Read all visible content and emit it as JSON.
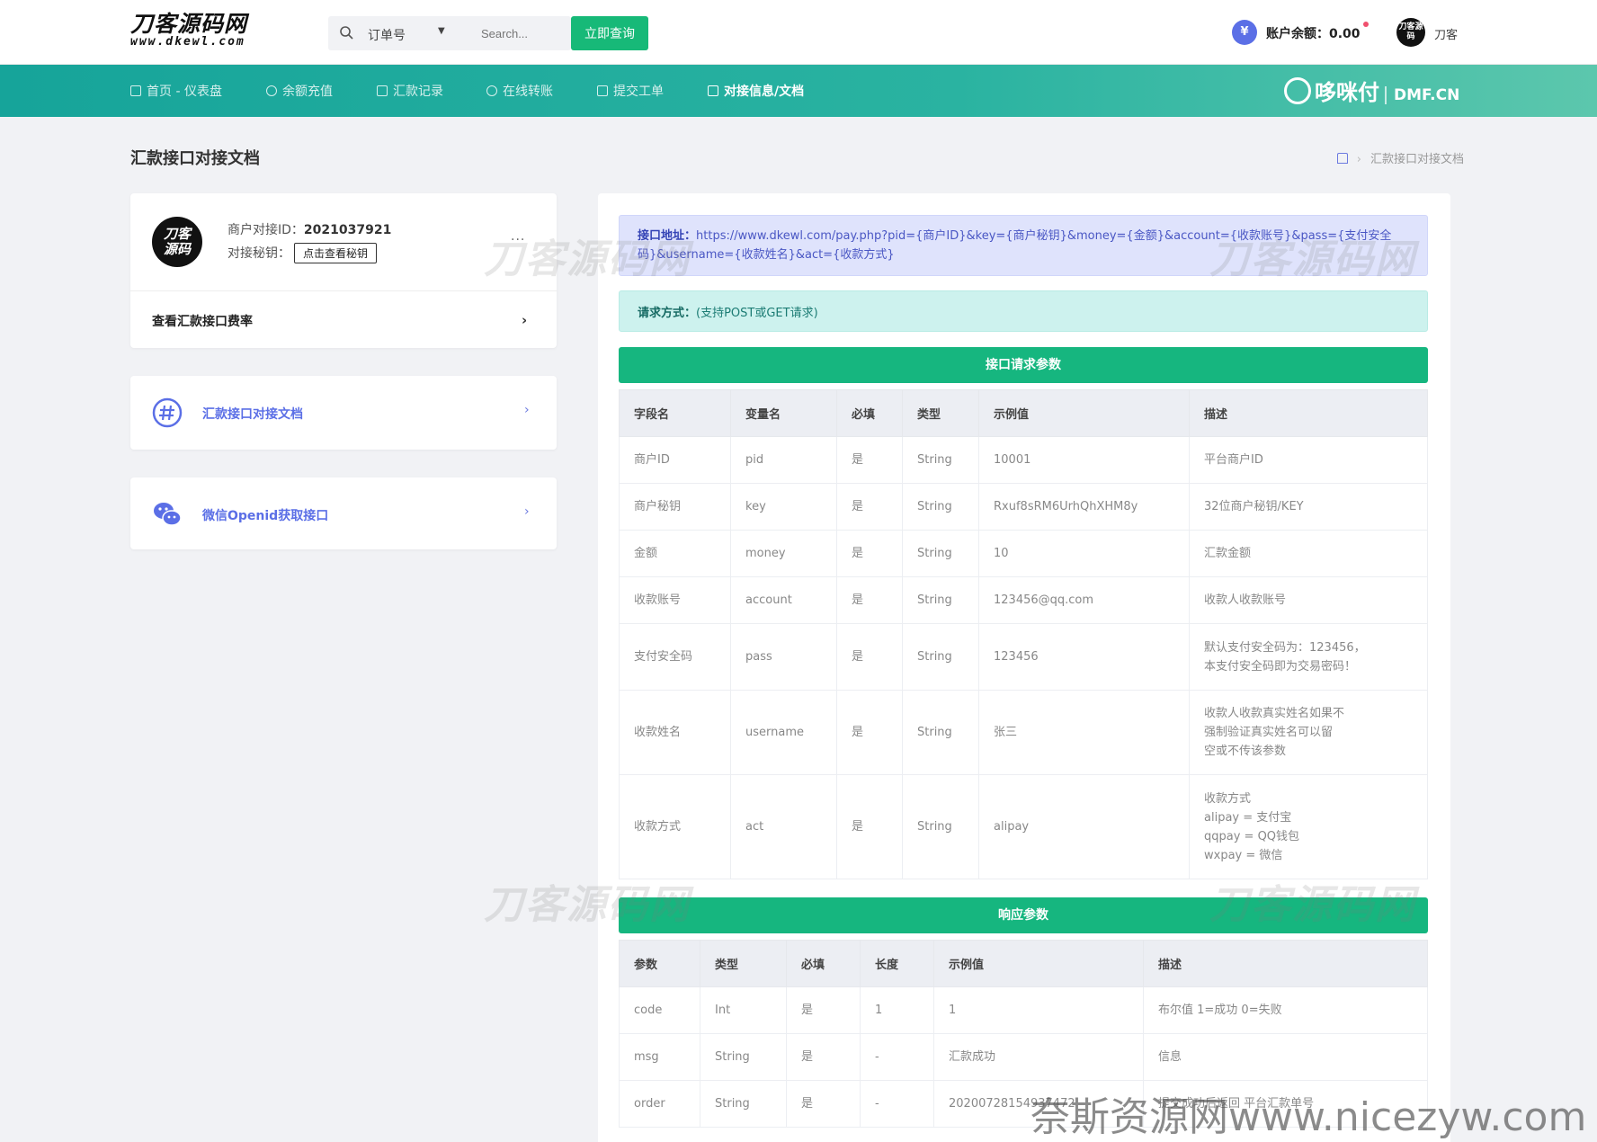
{
  "header": {
    "logo_line1": "刀客源码网",
    "logo_line2": "www.dkewl.com",
    "search_select": "订单号",
    "search_placeholder": "Search...",
    "query_button": "立即查询",
    "balance_symbol": "¥",
    "balance_label": "账户余额：0.00",
    "avatar_text": "刀客源码",
    "user_name": "刀客"
  },
  "nav": {
    "items": [
      {
        "label": "首页 - 仪表盘"
      },
      {
        "label": "余额充值"
      },
      {
        "label": "汇款记录"
      },
      {
        "label": "在线转账"
      },
      {
        "label": "提交工单"
      },
      {
        "label": "对接信息/文档"
      }
    ],
    "brand": "哆咪付",
    "brand_domain": "DMF.CN"
  },
  "page": {
    "title": "汇款接口对接文档",
    "breadcrumb_sep": "›",
    "breadcrumb_current": "汇款接口对接文档"
  },
  "merchant": {
    "logo_text_1": "刀客",
    "logo_text_2": "源码",
    "id_label": "商户对接ID：",
    "id_value": "2021037921",
    "key_label": "对接秘钥：",
    "key_button": "点击查看秘钥",
    "menu": "···",
    "rate_link": "查看汇款接口费率",
    "arrow": "›"
  },
  "links": [
    {
      "label": "汇款接口对接文档",
      "arrow": "›"
    },
    {
      "label": "微信Openid获取接口",
      "arrow": "›"
    }
  ],
  "api": {
    "url_label": "接口地址：",
    "url_value": "https://www.dkewl.com/pay.php?pid={商户ID}&key={商户秘钥}&money={金额}&account={收款账号}&pass={支付安全码}&username={收款姓名}&act={收款方式}",
    "method_label": "请求方式：",
    "method_value": "(支持POST或GET请求)"
  },
  "request_params": {
    "title": "接口请求参数",
    "headers": [
      "字段名",
      "变量名",
      "必填",
      "类型",
      "示例值",
      "描述"
    ],
    "rows": [
      [
        "商户ID",
        "pid",
        "是",
        "String",
        "10001",
        "平台商户ID"
      ],
      [
        "商户秘钥",
        "key",
        "是",
        "String",
        "Rxuf8sRM6UrhQhXHM8y",
        "32位商户秘钥/KEY"
      ],
      [
        "金额",
        "money",
        "是",
        "String",
        "10",
        "汇款金额"
      ],
      [
        "收款账号",
        "account",
        "是",
        "String",
        "123456@qq.com",
        "收款人收款账号"
      ],
      [
        "支付安全码",
        "pass",
        "是",
        "String",
        "123456",
        "默认支付安全码为：123456，\n本支付安全码即为交易密码！"
      ],
      [
        "收款姓名",
        "username",
        "是",
        "String",
        "张三",
        "收款人收款真实姓名如果不\n强制验证真实姓名可以留\n空或不传该参数"
      ],
      [
        "收款方式",
        "act",
        "是",
        "String",
        "alipay",
        "收款方式\nalipay = 支付宝\nqqpay = QQ钱包\nwxpay = 微信"
      ]
    ]
  },
  "response_params": {
    "title": "响应参数",
    "headers": [
      "参数",
      "类型",
      "必填",
      "长度",
      "示例值",
      "描述"
    ],
    "rows": [
      [
        "code",
        "Int",
        "是",
        "1",
        "1",
        "布尔值 1=成功 0=失败"
      ],
      [
        "msg",
        "String",
        "是",
        "-",
        "汇款成功",
        "信息"
      ],
      [
        "order",
        "String",
        "是",
        "-",
        "20200728154937472",
        "提交成功后返回 平台汇款单号"
      ]
    ]
  },
  "watermarks": {
    "logo": "刀客源码网",
    "bottom": "奈斯资源网www.nicezyw.com"
  },
  "colors": {
    "accent_green": "#17b978",
    "nav_teal": "#16a49a",
    "link_blue": "#5b6fe6"
  }
}
